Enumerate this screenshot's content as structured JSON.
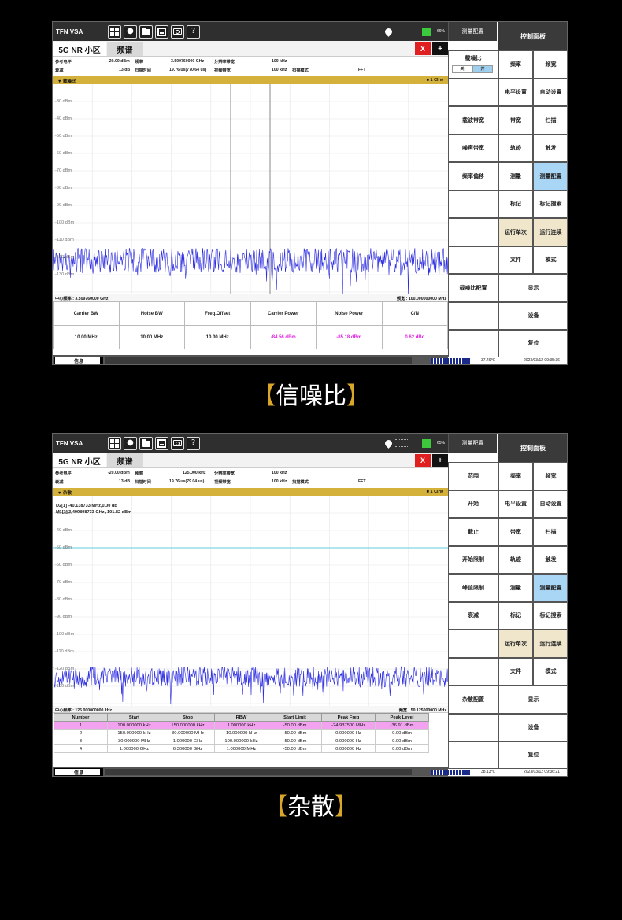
{
  "common": {
    "app_name": "TFN VSA",
    "tab_cell": "5G NR 小区",
    "tab_spectrum": "频谱",
    "close_label": "X",
    "add_label": "+",
    "ctrl_panel": "控制面板",
    "info_button": "信息",
    "info_row1": {
      "ref_label": "参考电平",
      "ref_value": "-20.00 dBm",
      "freq_label": "频率",
      "rbw_label": "分辨率带宽",
      "rbw_value": "100 kHz"
    },
    "info_row2": {
      "att_label": "衰减",
      "att_value": "13 dB",
      "sweep_label": "扫描时间",
      "vbw_label": "视频带宽",
      "vbw_value": "100 kHz",
      "mode_label": "扫描模式",
      "mode_value": "FFT"
    },
    "trace_mode": "1 Clrw"
  },
  "snr": {
    "battery": "66%",
    "measure_config": "测量配置",
    "freq_value": "3.509760000 GHz",
    "sweep_value": "19.76 us(770.64 us)",
    "plot_title": "载噪比",
    "y_ticks": [
      "-30 dBm",
      "-40 dBm",
      "-50 dBm",
      "-60 dBm",
      "-70 dBm",
      "-80 dBm",
      "-90 dBm",
      "-100 dBm",
      "-110 dBm",
      "-120 dBm",
      "-130 dBm"
    ],
    "center_freq": "中心频率 : 3.509760000 GHz",
    "span": "频宽 : 100.000000000 MHz",
    "table_headers": [
      "Carrier BW",
      "Noise BW",
      "Freq.Offset",
      "Carrier Power",
      "Noise Power",
      "C/N"
    ],
    "table_values": [
      "10.00 MHz",
      "10.00 MHz",
      "10.00 MHz",
      "-84.56 dBm",
      "-85.18 dBm",
      "0.62 dBc"
    ],
    "temp": "37.49℃",
    "datetime": "2023/03/12 09:35:36",
    "left_menu": {
      "snr_label": "载噪比",
      "toggle_off": "关",
      "toggle_on": "开",
      "carrier_bw": "载波带宽",
      "noise_bw": "噪声带宽",
      "freq_offset": "频率偏移",
      "snr_config": "载噪比配置"
    },
    "caption": "信噪比"
  },
  "spur": {
    "battery": "65%",
    "measure_config": "测量配置",
    "freq_value": "125.000 kHz",
    "sweep_value": "19.76 us(79.04 us)",
    "plot_title": "杂散",
    "marker1": "D2[1]      -40.138733 MHz,0.00 dB",
    "marker2": "M1[1]      3.499898733 GHz,-101.82 dBm",
    "y_ticks": [
      "-30 dBm",
      "-40 dBm",
      "-50 dBm",
      "-60 dBm",
      "-70 dBm",
      "-80 dBm",
      "-90 dBm",
      "-100 dBm",
      "-110 dBm",
      "-120 dBm",
      "-130 dBm"
    ],
    "center_freq": "中心频率 : 125.000000000 kHz",
    "span": "频宽 : 50.125000000 MHz",
    "table_headers": [
      "Number",
      "Start",
      "Stop",
      "RBW",
      "Start Limit",
      "Peak Freq",
      "Peak Level"
    ],
    "table_rows": [
      [
        "1",
        "100.000000 kHz",
        "150.000000 kHz",
        "1.000000 kHz",
        "-50.00 dBm",
        "-24.937500 MHz",
        "-36.91 dBm"
      ],
      [
        "2",
        "150.000000 kHz",
        "30.000000 MHz",
        "10.000000 kHz",
        "-50.00 dBm",
        "0.000000 Hz",
        "0.00 dBm"
      ],
      [
        "3",
        "30.000000 MHz",
        "1.000000 GHz",
        "100.000000 kHz",
        "-50.00 dBm",
        "0.000000 Hz",
        "0.00 dBm"
      ],
      [
        "4",
        "1.000000 GHz",
        "6.300000 GHz",
        "1.000000 MHz",
        "-50.00 dBm",
        "0.000000 Hz",
        "0.00 dBm"
      ]
    ],
    "temp": "38.13℃",
    "datetime": "2023/03/12 09:36:21",
    "left_menu": {
      "range": "范围",
      "start": "开始",
      "stop": "截止",
      "start_limit": "开始限制",
      "peak_limit": "峰值限制",
      "atten": "衰减",
      "spur_config": "杂散配置"
    },
    "caption": "杂散"
  },
  "right_menu": {
    "freq": "频率",
    "span": "频宽",
    "level": "电平设置",
    "autoset": "自动设置",
    "bw": "带宽",
    "sweep": "扫描",
    "trace": "轨迹",
    "trigger": "触发",
    "measure": "测量",
    "measure_cfg": "测量配置",
    "marker": "标记",
    "marker_search": "标记搜索",
    "run_single": "运行单次",
    "run_cont": "运行连续",
    "file": "文件",
    "mode": "模式",
    "display": "显示",
    "device": "设备",
    "reset": "复位"
  },
  "caption_brackets": {
    "open": "【",
    "close": "】"
  },
  "colors": {
    "trace": "#2a2ae0",
    "header_gold": "#d4b13a",
    "highlight": "#f2a2ef",
    "limit_line": "#7fd8e6",
    "selected": "#a9d6f5"
  }
}
